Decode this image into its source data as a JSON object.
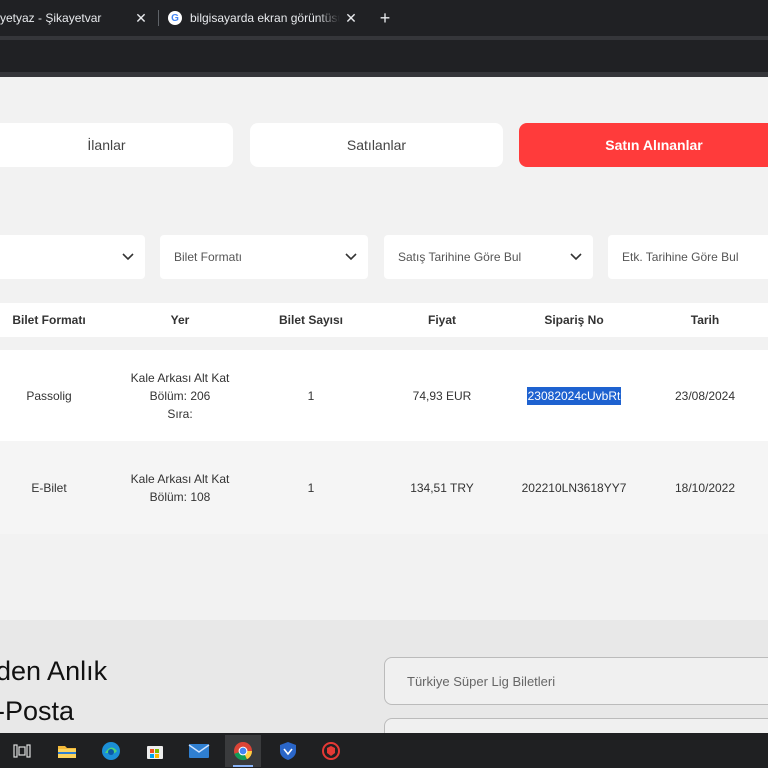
{
  "browser": {
    "tabs": [
      {
        "title": "yetyaz - Şikayetvar"
      },
      {
        "title": "bilgisayarda ekran görüntüsü alma"
      }
    ],
    "new_tab_label": "+"
  },
  "page_tabs": [
    {
      "label": "İlanlar",
      "active": false
    },
    {
      "label": "Satılanlar",
      "active": false
    },
    {
      "label": "Satın Alınanlar",
      "active": true
    }
  ],
  "filters": [
    {
      "label": ""
    },
    {
      "label": "Bilet Formatı"
    },
    {
      "label": "Satış Tarihine Göre Bul"
    },
    {
      "label": "Etk. Tarihine Göre Bul"
    }
  ],
  "table": {
    "headers": [
      "Bilet Formatı",
      "Yer",
      "Bilet Sayısı",
      "Fiyat",
      "Sipariş No",
      "Tarih"
    ],
    "rows": [
      {
        "format": "Passolig",
        "yer": [
          "Kale Arkası Alt Kat",
          "Bölüm: 206",
          "Sıra:"
        ],
        "count": "1",
        "price": "74,93 EUR",
        "order_no": "23082024cUvbRt",
        "date": "23/08/2024"
      },
      {
        "format": "E-Bilet",
        "yer": [
          "Kale Arkası Alt Kat",
          "Bölüm: 108"
        ],
        "count": "1",
        "price": "134,51 TRY",
        "order_no": "202210LN3618YY7",
        "date": "18/10/2022"
      }
    ]
  },
  "newsletter": {
    "heading_line1": "den Anlık",
    "heading_line2": "-Posta",
    "input_placeholder": "Türkiye Süper Lig Biletleri"
  },
  "taskbar": {
    "icons": [
      "task-view-icon",
      "file-explorer-icon",
      "edge-icon",
      "store-icon",
      "mail-icon",
      "chrome-icon",
      "vpn-shield-icon",
      "security-app-icon"
    ],
    "active": "chrome-icon"
  },
  "colors": {
    "accent": "#ff3b3b",
    "selection": "#1e62d0",
    "browser_dark": "#202124"
  }
}
